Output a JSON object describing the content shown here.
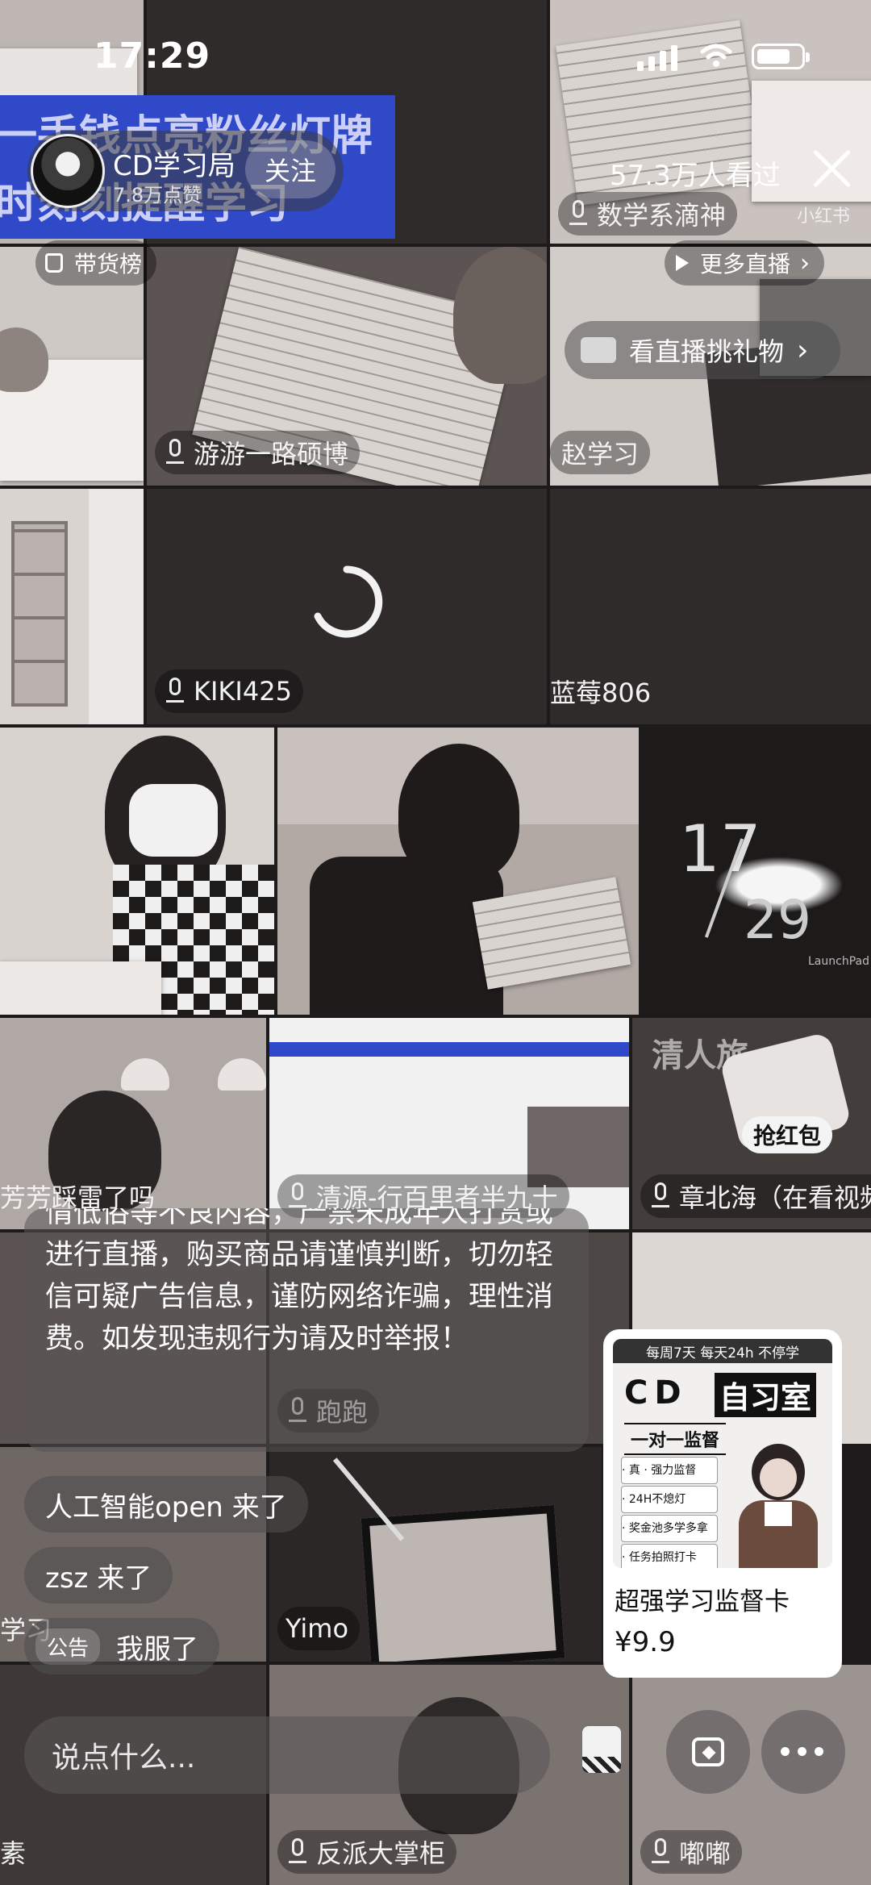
{
  "status_bar": {
    "time": "17:29"
  },
  "banner": {
    "line1": "一手钱点亮粉丝灯牌",
    "line2": "时刻刻提醒学习"
  },
  "host": {
    "name": "CD学习局",
    "likes": "7.8万点赞",
    "follow_label": "关注"
  },
  "viewers": "57.3万人看过",
  "watermark": "小红书",
  "top_tile_name": "数学系滴神",
  "charts_label": "带货榜",
  "more_live_label": "更多直播",
  "gift_label": "看直播挑礼物",
  "tiles": [
    {
      "name": "游游一路硕博"
    },
    {
      "name": "赵学习"
    },
    {
      "name": "KIKI425"
    },
    {
      "name": "蓝莓806"
    },
    {
      "name": "芳芳踩雷了吗"
    },
    {
      "name": "清源-行百里者半九十"
    },
    {
      "name": "章北海（在看视频"
    },
    {
      "name": "跑跑"
    },
    {
      "name": "学习"
    },
    {
      "name": "Yimo"
    },
    {
      "name": "素"
    },
    {
      "name": "反派大掌柜"
    },
    {
      "name": "嘟嘟"
    }
  ],
  "clock_widget": {
    "hour": "17",
    "minute": "29",
    "brand": "LaunchPad"
  },
  "red_packet_label": "抢红包",
  "notice_text": "情低俗等不良内容，严禁未成年人打赏或进行直播，购买商品请谨慎判断，切勿轻信可疑广告信息，谨防网络诈骗，理性消费。如发现违规行为请及时举报！",
  "chat_messages": [
    {
      "text": "人工智能open 来了"
    },
    {
      "text": "zsz 来了"
    }
  ],
  "announcement": {
    "tag": "公告",
    "text": "我服了"
  },
  "product": {
    "tagline": "每周7天 每天24h 不停学",
    "brand_cd": "CD",
    "brand_title": "自习室",
    "subtitle": "一对一监督",
    "features": [
      "· 真 · 强力监督",
      "· 24H不熄灯",
      "· 奖金池多学多拿",
      "· 任务拍照打卡"
    ],
    "title": "超强学习监督卡",
    "price": "¥9.9"
  },
  "input_placeholder": "说点什么...",
  "icons": [
    "signal-icon",
    "wifi-icon",
    "battery-icon",
    "close-icon",
    "bag-icon",
    "play-icon",
    "chevron-right-icon",
    "mic-icon",
    "loading-spinner-icon",
    "shopping-bag-icon",
    "heart-bag-icon",
    "more-icon"
  ]
}
